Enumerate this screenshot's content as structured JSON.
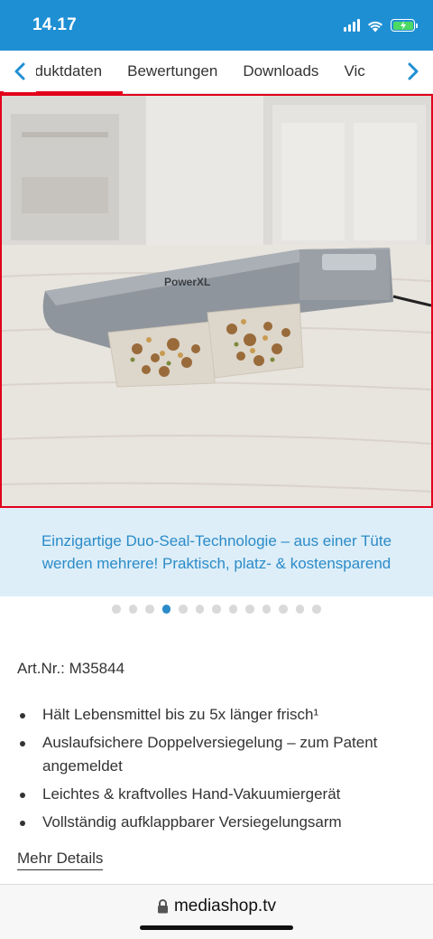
{
  "status_bar": {
    "time": "14.17",
    "battery_color": "#4cd964"
  },
  "tabs": {
    "prev_icon": "chevron-left-icon",
    "next_icon": "chevron-right-icon",
    "items": [
      {
        "label": "oduktdaten"
      },
      {
        "label": "Bewertungen"
      },
      {
        "label": "Downloads"
      },
      {
        "label": "Vic"
      }
    ],
    "active_color": "#e2001a"
  },
  "hero": {
    "brand_logo": "PowerXL",
    "alt": "PowerXL vacuum sealer with food bags"
  },
  "caption": "Einzigartige Duo-Seal-Technologie – aus einer Tüte werden mehrere! Praktisch, platz- & kostensparend",
  "carousel": {
    "total": 13,
    "active_index": 3,
    "active_color": "#2b8bc8"
  },
  "product": {
    "art_nr": "Art.Nr.: M35844",
    "features": [
      "Hält Lebensmittel bis zu 5x länger frisch¹",
      "Auslaufsichere Doppelversiegelung – zum Patent angemeldet",
      "Leichtes & kraftvolles Hand-Vakuumiergerät",
      "Vollständig aufklappbarer Versiegelungsarm"
    ],
    "more_label": "Mehr Details"
  },
  "browser": {
    "url": "mediashop.tv",
    "lock_icon": "lock-icon"
  },
  "colors": {
    "brand_blue": "#1f8fd3",
    "caption_bg": "#ddeef8",
    "caption_text": "#2b8bc8"
  }
}
